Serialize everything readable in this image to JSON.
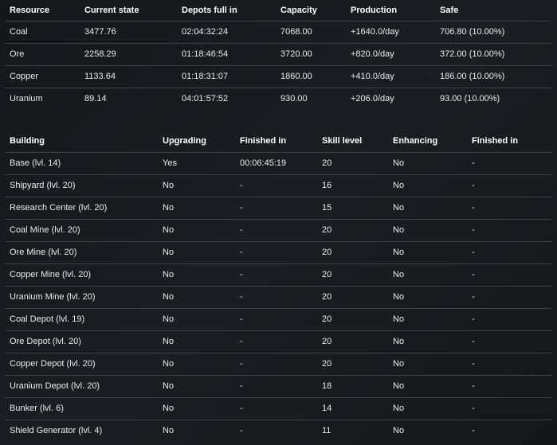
{
  "resources": {
    "headers": [
      "Resource",
      "Current state",
      "Depots full in",
      "Capacity",
      "Production",
      "Safe"
    ],
    "rows": [
      [
        "Coal",
        "3477.76",
        "02:04:32:24",
        "7068.00",
        "+1640.0/day",
        "706.80 (10.00%)"
      ],
      [
        "Ore",
        "2258.29",
        "01:18:46:54",
        "3720.00",
        "+820.0/day",
        "372.00 (10.00%)"
      ],
      [
        "Copper",
        "1133.64",
        "01:18:31:07",
        "1860.00",
        "+410.0/day",
        "186.00 (10.00%)"
      ],
      [
        "Uranium",
        "89.14",
        "04:01:57:52",
        "930.00",
        "+206.0/day",
        "93.00 (10.00%)"
      ]
    ]
  },
  "buildings": {
    "headers": [
      "Building",
      "Upgrading",
      "Finished in",
      "Skill level",
      "Enhancing",
      "Finished in"
    ],
    "rows": [
      [
        "Base (lvl. 14)",
        "Yes",
        "00:06:45:19",
        "20",
        "No",
        "-"
      ],
      [
        "Shipyard (lvl. 20)",
        "No",
        "-",
        "16",
        "No",
        "-"
      ],
      [
        "Research Center (lvl. 20)",
        "No",
        "-",
        "15",
        "No",
        "-"
      ],
      [
        "Coal Mine (lvl. 20)",
        "No",
        "-",
        "20",
        "No",
        "-"
      ],
      [
        "Ore Mine (lvl. 20)",
        "No",
        "-",
        "20",
        "No",
        "-"
      ],
      [
        "Copper Mine (lvl. 20)",
        "No",
        "-",
        "20",
        "No",
        "-"
      ],
      [
        "Uranium Mine (lvl. 20)",
        "No",
        "-",
        "20",
        "No",
        "-"
      ],
      [
        "Coal Depot (lvl. 19)",
        "No",
        "-",
        "20",
        "No",
        "-"
      ],
      [
        "Ore Depot (lvl. 20)",
        "No",
        "-",
        "20",
        "No",
        "-"
      ],
      [
        "Copper Depot (lvl. 20)",
        "No",
        "-",
        "20",
        "No",
        "-"
      ],
      [
        "Uranium Depot (lvl. 20)",
        "No",
        "-",
        "18",
        "No",
        "-"
      ],
      [
        "Bunker (lvl. 6)",
        "No",
        "-",
        "14",
        "No",
        "-"
      ],
      [
        "Shield Generator (lvl. 4)",
        "No",
        "-",
        "11",
        "No",
        "-"
      ]
    ]
  }
}
